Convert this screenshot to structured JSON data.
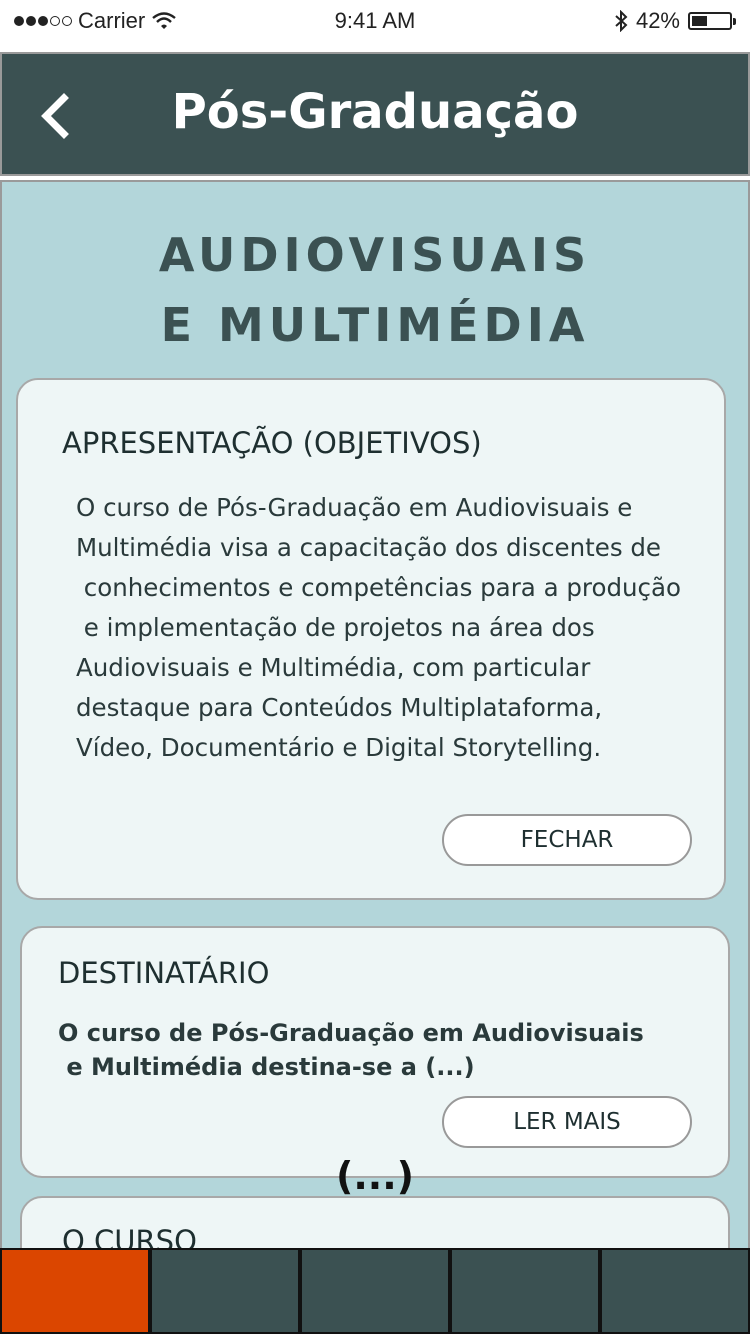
{
  "status_bar": {
    "carrier": "Carrier",
    "time": "9:41 AM",
    "battery_percent": "42%",
    "battery_level": 0.42,
    "icons": [
      "signal-dots-icon",
      "wifi-icon",
      "bluetooth-icon",
      "battery-icon"
    ]
  },
  "header": {
    "title": "Pós-Graduação",
    "back_icon": "chevron-left-icon"
  },
  "section": {
    "title_line1": "AUDIOVISUAIS",
    "title_line2": "E MULTIMÉDIA"
  },
  "cards": [
    {
      "title": "APRESENTAÇÃO (OBJETIVOS)",
      "body": "O curso de Pós-Graduação em Audiovisuais e\nMultimédia visa a capacitação dos discentes de\n conhecimentos e competências para a produção\n e implementação de projetos na área dos\nAudiovisuais e Multimédia, com particular\ndestaque para Conteúdos Multiplataforma,\nVídeo, Documentário e Digital Storytelling.",
      "button": "FECHAR"
    },
    {
      "title": "DESTINATÁRIO",
      "body": "O curso de Pós-Graduação em Audiovisuais\n e Multimédia destina-se a (...)",
      "button": "LER MAIS"
    },
    {
      "title": "O CURSO"
    }
  ],
  "ellipsis": "(...)",
  "tabbar": {
    "active_index": 0,
    "colors": {
      "active": "#db4600",
      "inactive": "#3b5152"
    }
  },
  "colors": {
    "header_bg": "#3b5152",
    "content_bg": "#b3d6da",
    "card_bg": "#eef6f6",
    "title_text": "#3b5152"
  }
}
